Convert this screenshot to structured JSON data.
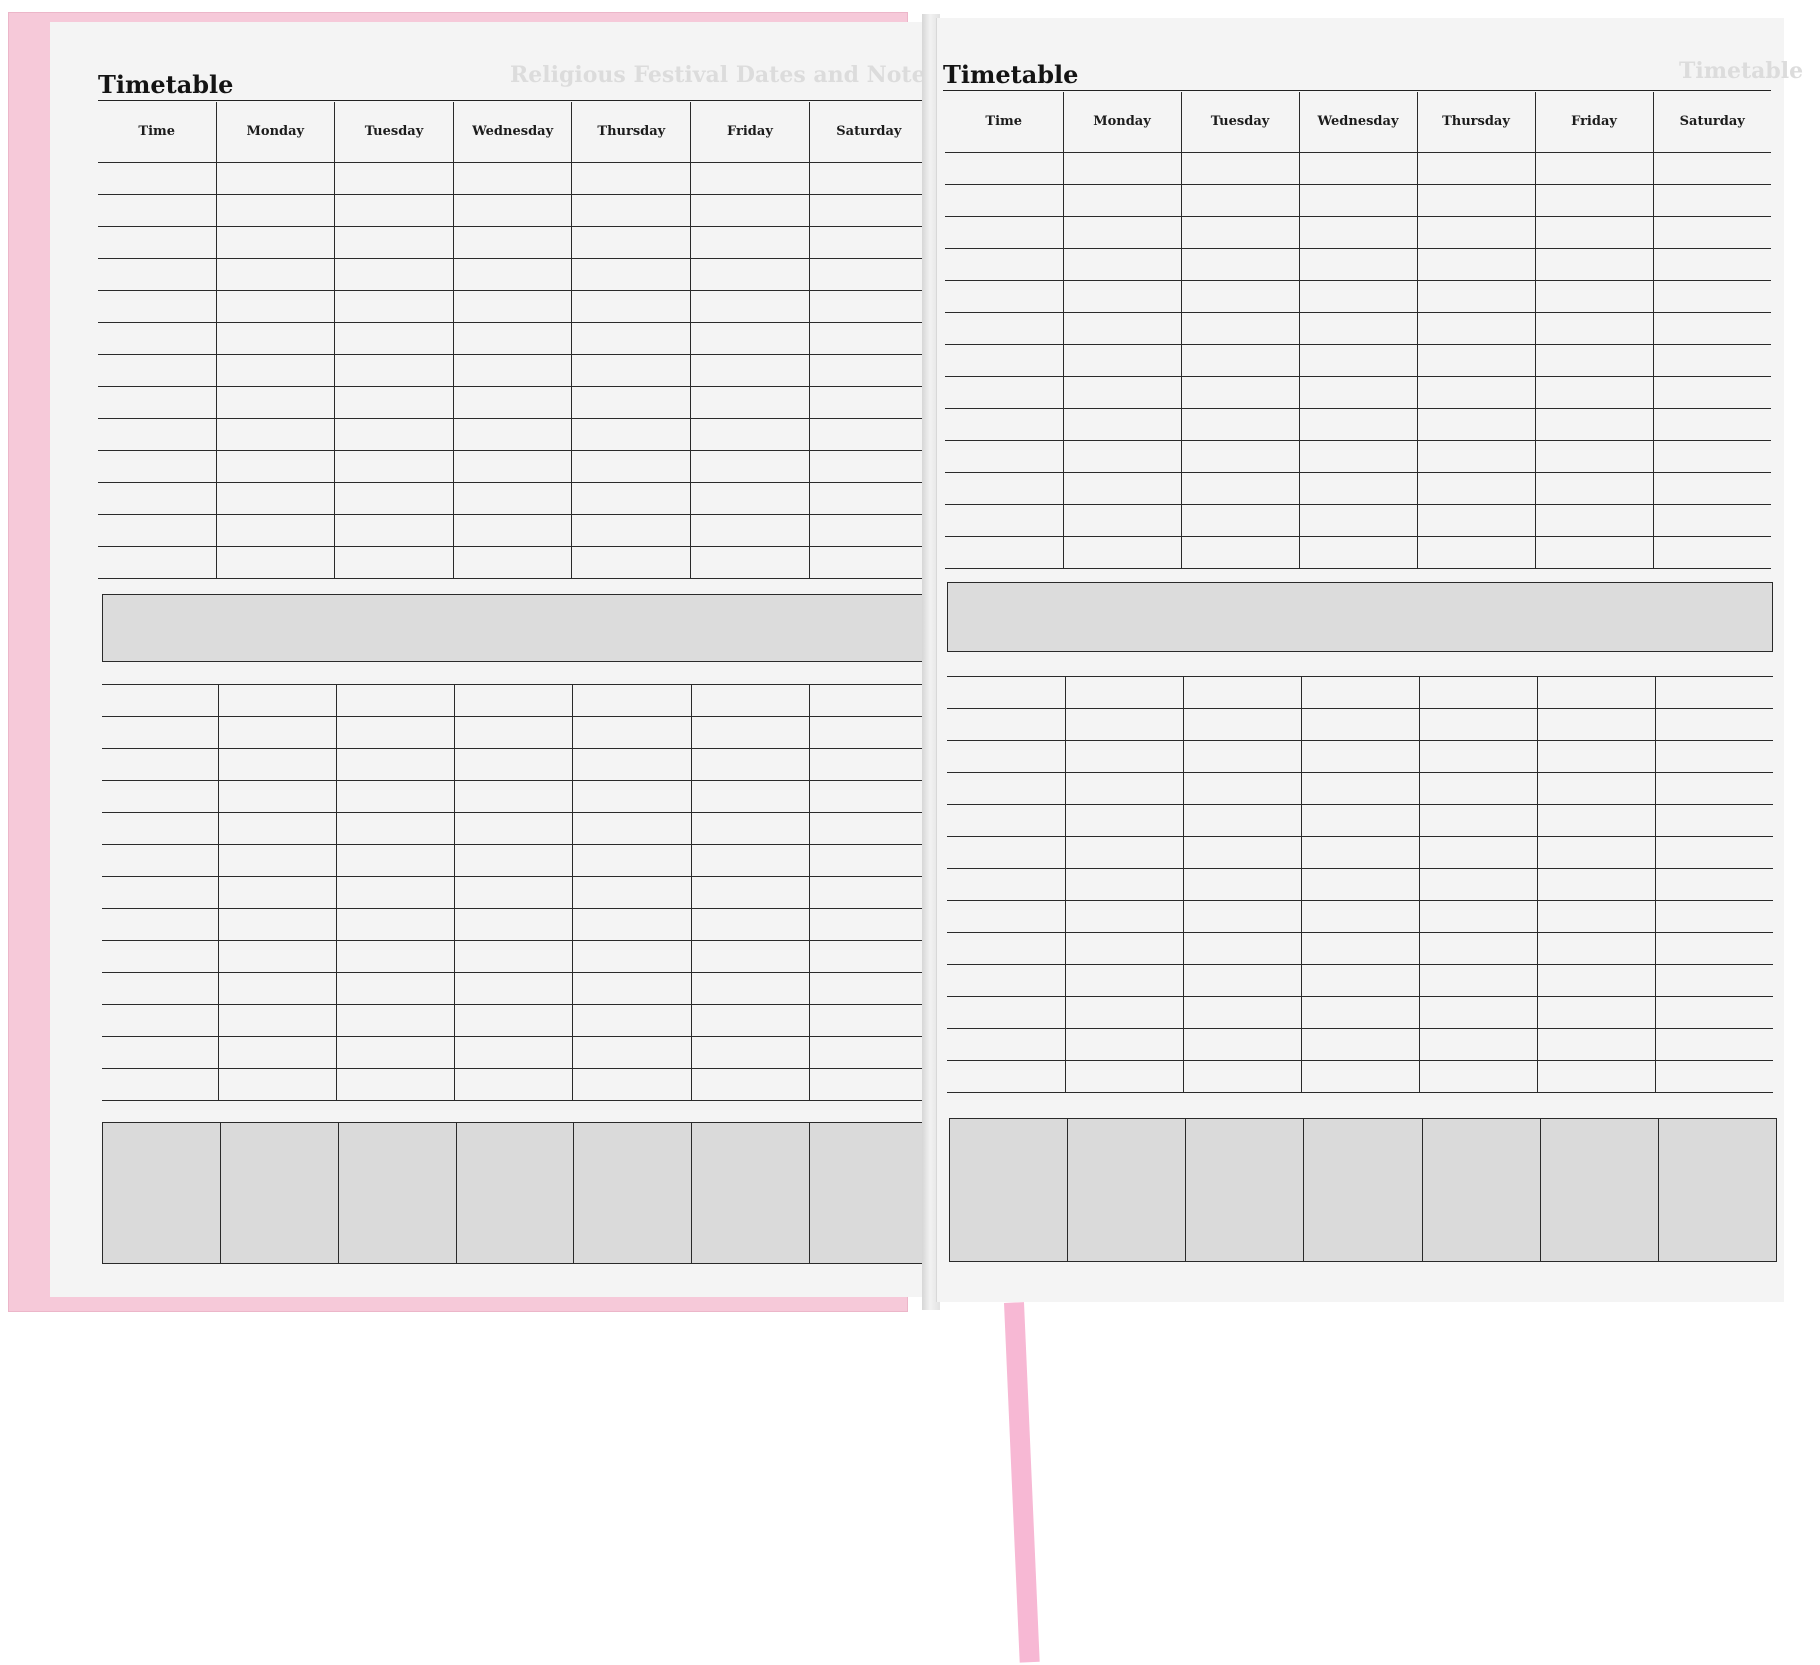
{
  "left_page": {
    "title": "Timetable",
    "show_through": "Religious Festival Dates and Notes"
  },
  "right_page": {
    "title": "Timetable",
    "show_through": "Timetable"
  },
  "columns": [
    "Time",
    "Monday",
    "Tuesday",
    "Wednesday",
    "Thursday",
    "Friday",
    "Saturday"
  ],
  "colors": {
    "cover": "#f6c9d9",
    "ribbon": "#f7b8d4",
    "paper": "#f4f4f4",
    "shaded_band": "#dcdcdc",
    "ink": "#1c1c1c"
  }
}
